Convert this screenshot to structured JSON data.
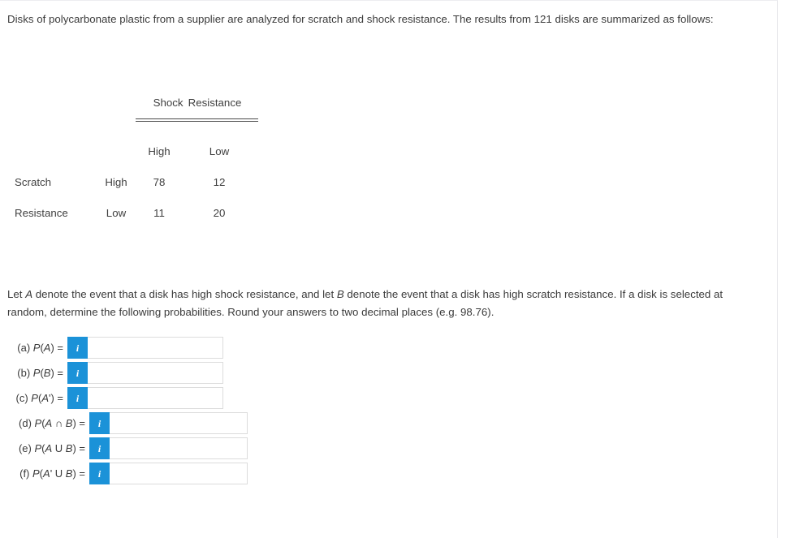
{
  "intro": {
    "text": "Disks of polycarbonate plastic from a supplier are analyzed for scratch and shock resistance. The results from  121 disks are summarized as follows:"
  },
  "table": {
    "supertitle_left": "Shock",
    "supertitle_right": "Resistance",
    "stub_line1": "Scratch",
    "stub_line2": "Resistance",
    "column_headers": [
      "High",
      "Low"
    ],
    "row_labels": [
      "High",
      "Low"
    ],
    "cells": [
      [
        "78",
        "12"
      ],
      [
        "11",
        "20"
      ]
    ]
  },
  "prompt": {
    "part1": "Let ",
    "var_a": "A",
    "part2": " denote the event that a disk has high shock resistance, and let ",
    "var_b": "B",
    "part3": " denote the event that a disk has high scratch resistance. If a disk is selected at random, determine the following probabilities. Round your answers to two decimal places (e.g. 98.76)."
  },
  "answers": {
    "info_icon_glyph": "i",
    "info_icon_name": "info-icon",
    "accent_color": "#1b92d8",
    "items": [
      {
        "key": "a",
        "label": "(a) P(A) =",
        "value": "",
        "placeholder": ""
      },
      {
        "key": "b",
        "label": "(b) P(B) =",
        "value": "",
        "placeholder": ""
      },
      {
        "key": "c",
        "label": "(c) P(A') =",
        "value": "",
        "placeholder": ""
      },
      {
        "key": "d",
        "label": "(d) P(A ∩ B) =",
        "value": "",
        "placeholder": ""
      },
      {
        "key": "e",
        "label": "(e) P(A U B) =",
        "value": "",
        "placeholder": ""
      },
      {
        "key": "f",
        "label": "(f) P(A' U B) =",
        "value": "",
        "placeholder": ""
      }
    ]
  }
}
